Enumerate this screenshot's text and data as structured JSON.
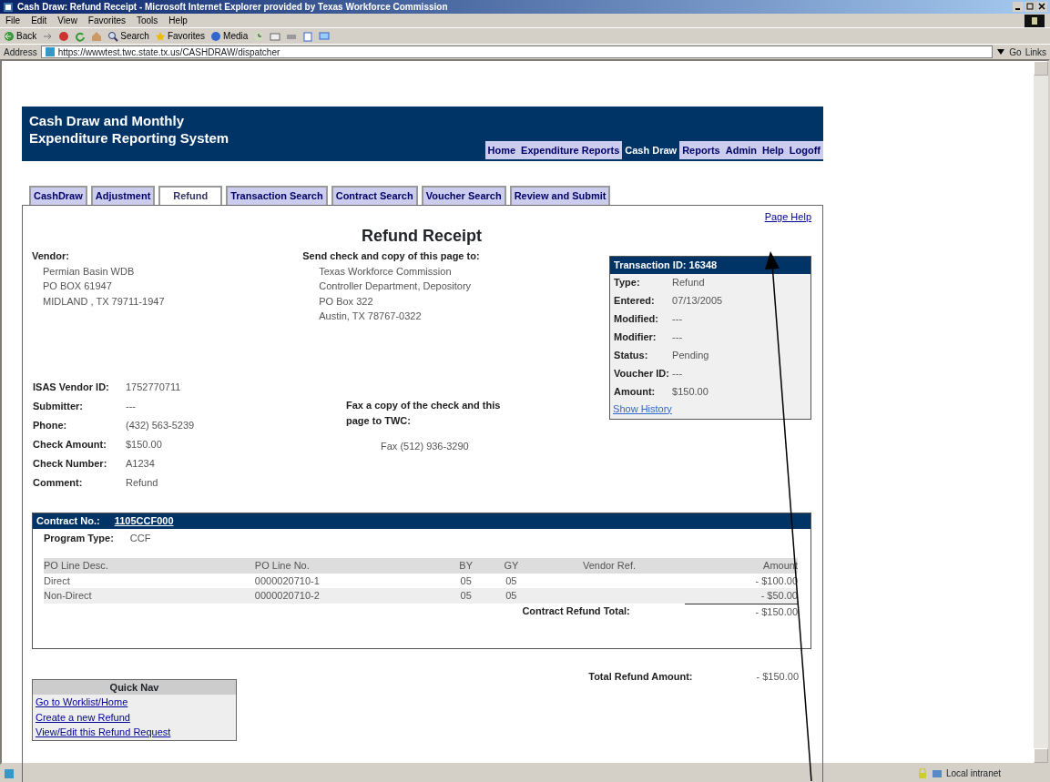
{
  "window": {
    "title": "Cash Draw: Refund Receipt - Microsoft Internet Explorer provided by Texas Workforce Commission"
  },
  "menu": [
    "File",
    "Edit",
    "View",
    "Favorites",
    "Tools",
    "Help"
  ],
  "toolbar": [
    {
      "label": "Back",
      "kind": "back"
    },
    {
      "kind": "forward"
    },
    {
      "kind": "stop"
    },
    {
      "kind": "refresh"
    },
    {
      "kind": "home"
    },
    {
      "label": "Search",
      "kind": "search"
    },
    {
      "label": "Favorites",
      "kind": "favorites"
    },
    {
      "label": "Media",
      "kind": "media"
    },
    {
      "kind": "history"
    },
    {
      "kind": "mail"
    },
    {
      "kind": "print"
    },
    {
      "kind": "edit"
    },
    {
      "kind": "discuss"
    }
  ],
  "address": {
    "label": "Address",
    "url": "https://wwwtest.twc.state.tx.us/CASHDRAW/dispatcher",
    "go": "Go",
    "links": "Links"
  },
  "header": {
    "title_lines": [
      "Cash Draw and Monthly",
      "Expenditure Reporting System"
    ],
    "nav": [
      {
        "label": "Home",
        "selected": false
      },
      {
        "label": "Expenditure Reports",
        "selected": false
      },
      {
        "label": "Cash Draw",
        "selected": true
      },
      {
        "label": "Reports",
        "selected": false
      },
      {
        "label": "Admin",
        "selected": false
      },
      {
        "label": "Help",
        "selected": false
      },
      {
        "label": "Logoff",
        "selected": false
      }
    ]
  },
  "tabs": [
    {
      "label": "CashDraw",
      "selected": false
    },
    {
      "label": "Adjustment",
      "selected": false
    },
    {
      "label": "Refund",
      "selected": true
    },
    {
      "label": "Transaction Search",
      "selected": false
    },
    {
      "label": "Contract Search",
      "selected": false
    },
    {
      "label": "Voucher Search",
      "selected": false
    },
    {
      "label": "Review and Submit",
      "selected": false
    }
  ],
  "page_help": "Page Help",
  "heading": "Refund Receipt",
  "vendor": {
    "label": "Vendor:",
    "lines": [
      "Permian Basin WDB",
      "PO BOX 61947",
      "MIDLAND , TX 79711-1947"
    ]
  },
  "send_to": {
    "label": "Send check and copy of this page to:",
    "lines": [
      "Texas Workforce Commission",
      "Controller Department, Depository",
      "PO Box 322",
      "Austin, TX 78767-0322"
    ]
  },
  "transaction": {
    "title": "Transaction ID: 16348",
    "fields": [
      {
        "label": "Type:",
        "value": "Refund"
      },
      {
        "label": "Entered:",
        "value": "07/13/2005"
      },
      {
        "label": "Modified:",
        "value": "---"
      },
      {
        "label": "Modifier:",
        "value": "---"
      },
      {
        "label": "Status:",
        "value": "Pending"
      },
      {
        "label": "Voucher ID:",
        "value": "---"
      },
      {
        "label": "Amount:",
        "value": "$150.00"
      }
    ],
    "link": "Show History"
  },
  "details": [
    {
      "label": "ISAS Vendor ID:",
      "value": "1752770711"
    },
    {
      "label": "Submitter:",
      "value": "---"
    },
    {
      "label": "Phone:",
      "value": "(432) 563-5239"
    },
    {
      "label": "Check Amount:",
      "value": "$150.00"
    },
    {
      "label": "Check Number:",
      "value": "A1234"
    },
    {
      "label": "Comment:",
      "value": "Refund"
    }
  ],
  "fax": {
    "text": "Fax a copy of the check and this page to TWC:",
    "number": "Fax (512) 936-3290"
  },
  "contract": {
    "label": "Contract No.:",
    "number": "1105CCF000",
    "program_label": "Program Type:",
    "program_value": "CCF",
    "columns": [
      "PO Line Desc.",
      "PO Line No.",
      "BY",
      "GY",
      "Vendor Ref.",
      "Amount"
    ],
    "rows": [
      [
        "Direct",
        "0000020710-1",
        "05",
        "05",
        "",
        "- $100.00"
      ],
      [
        "Non-Direct",
        "0000020710-2",
        "05",
        "05",
        "",
        "- $50.00"
      ]
    ],
    "total_label": "Contract Refund Total:",
    "total_value": "- $150.00"
  },
  "total": {
    "label": "Total Refund Amount:",
    "value": "- $150.00"
  },
  "quick_nav": {
    "title": "Quick Nav",
    "links": [
      "Go to Worklist/Home",
      "Create a new Refund",
      "View/Edit this Refund Request"
    ]
  },
  "status_bar": {
    "zone": "Local intranet"
  }
}
